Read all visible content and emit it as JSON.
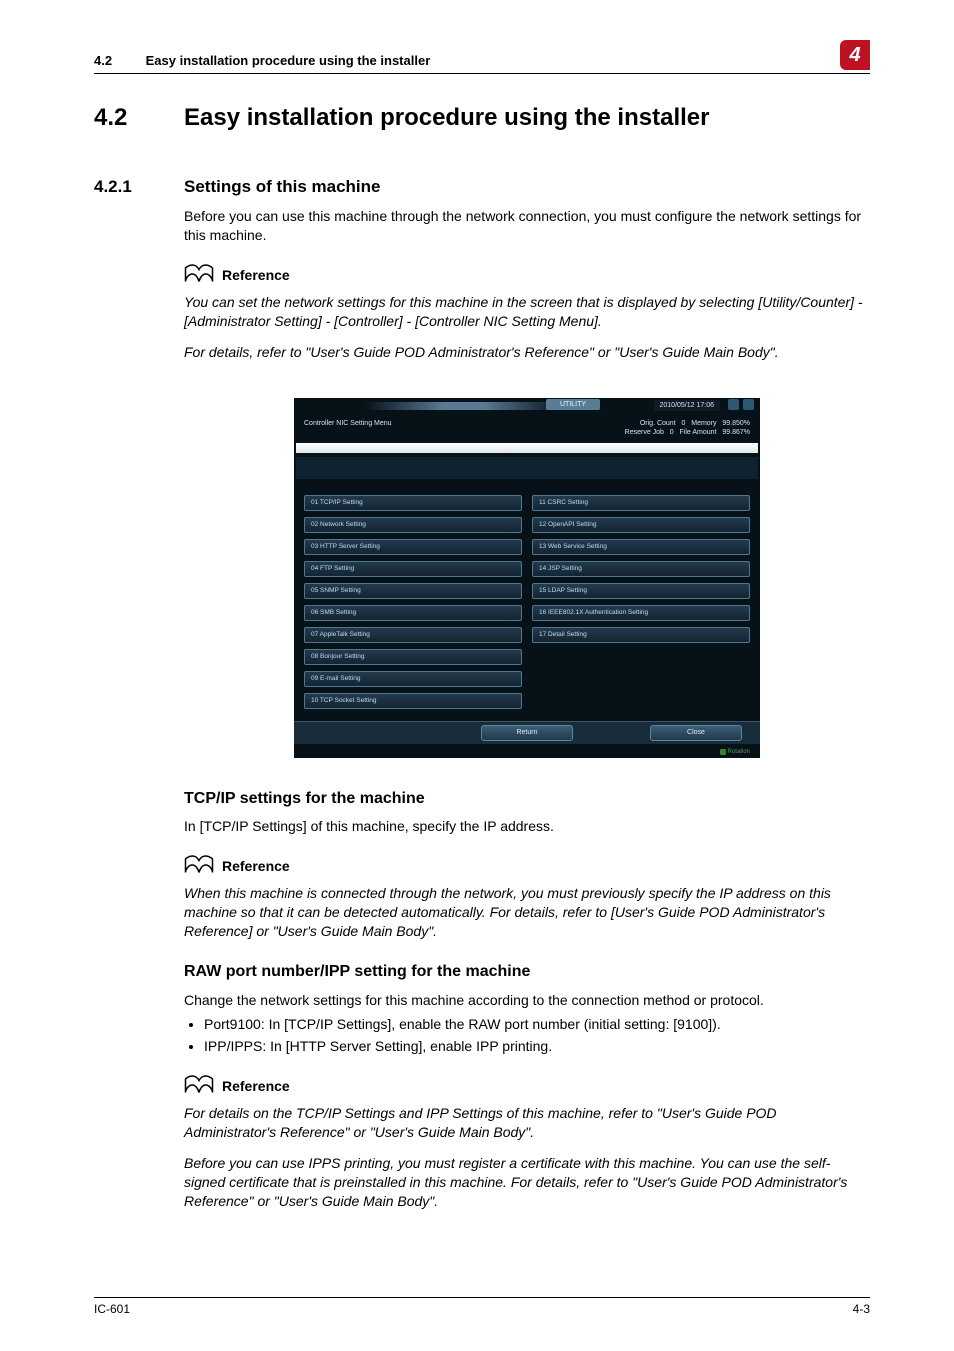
{
  "header": {
    "section_number": "4.2",
    "section_title": "Easy installation procedure using the installer",
    "badge": "4"
  },
  "h1": {
    "num": "4.2",
    "txt": "Easy installation procedure using the installer"
  },
  "h2": {
    "num": "4.2.1",
    "txt": "Settings of this machine"
  },
  "intro": "Before you can use this machine through the network connection, you must configure the network settings for this machine.",
  "ref_label": "Reference",
  "ref1a": "You can set the network settings for this machine in the screen that is displayed by selecting [Utility/Counter] - [Administrator Setting] - [Controller] - [Controller NIC Setting Menu].",
  "ref1b": "For details, refer to \"User's Guide POD Administrator's Reference\" or \"User's Guide Main Body\".",
  "screenshot": {
    "utility_label": "UTILITY",
    "datetime": "2010/05/12 17:06",
    "menu_title": "Controller NIC Setting Menu",
    "status": {
      "orig_count_label": "Orig. Count",
      "orig_count_val": "0",
      "memory_label": "Memory",
      "memory_val": "99.850%",
      "reserve_label": "Reserve Job",
      "reserve_val": "0",
      "file_label": "File Amount",
      "file_val": "99.867%"
    },
    "left_buttons": [
      "01 TCP/IP Setting",
      "02 Network Setting",
      "03 HTTP Server Setting",
      "04 FTP Setting",
      "05 SNMP Setting",
      "06 SMB Setting",
      "07 AppleTalk Setting",
      "08 Bonjour Setting",
      "09 E-mail Setting",
      "10 TCP Socket Setting"
    ],
    "right_buttons": [
      "11 CSRC Setting",
      "12 OpenAPI Setting",
      "13 Web Service Setting",
      "14 JSP Setting",
      "15 LDAP Setting",
      "16 IEEE802.1X Authentication Setting",
      "17 Detail Setting"
    ],
    "return_label": "Return",
    "close_label": "Close",
    "rotation_label": "Rotation"
  },
  "tcpip_head": "TCP/IP settings for the machine",
  "tcpip_para": "In [TCP/IP Settings] of this machine, specify the IP address.",
  "ref2": "When this machine is connected through the network, you must previously specify the IP address on this machine so that it can be detected automatically. For details, refer to [User's Guide POD Administrator's Reference] or \"User's Guide Main Body\".",
  "raw_head": "RAW port number/IPP setting for the machine",
  "raw_para": "Change the network settings for this machine according to the connection method or protocol.",
  "bullets": [
    "Port9100: In [TCP/IP Settings], enable the RAW port number (initial setting: [9100]).",
    "IPP/IPPS: In [HTTP Server Setting], enable IPP printing."
  ],
  "ref3a": "For details on the TCP/IP Settings and IPP Settings of this machine, refer to \"User's Guide POD Administrator's Reference\" or \"User's Guide Main Body\".",
  "ref3b": "Before you can use IPPS printing, you must register a certificate with this machine. You can use the self-signed certificate that is preinstalled in this machine. For details, refer to \"User's Guide POD Administrator's Reference\" or \"User's Guide Main Body\".",
  "footer": {
    "left": "IC-601",
    "right": "4-3"
  }
}
